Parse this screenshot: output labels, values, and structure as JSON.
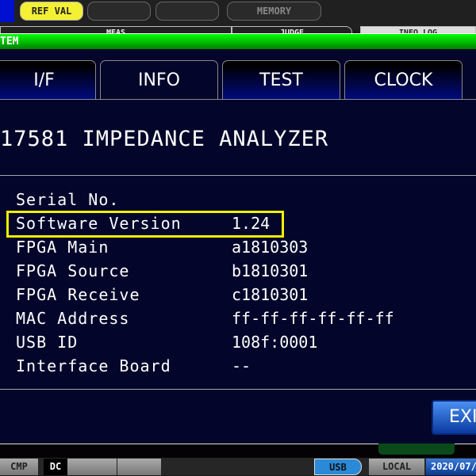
{
  "top_buttons": {
    "ref_val": "REF VAL",
    "btn2": "",
    "btn3": "",
    "memory": "MEMORY"
  },
  "behind_labels": {
    "meas": "MEAS",
    "judge": "JUDGE",
    "info_log": "INFO LOG"
  },
  "window_title": "TEM",
  "tabs": [
    {
      "label": "I/F"
    },
    {
      "label": "INFO",
      "active": true
    },
    {
      "label": "TEST"
    },
    {
      "label": "CLOCK"
    }
  ],
  "heading": "17581 IMPEDANCE ANALYZER",
  "info": [
    {
      "label": "Serial No.",
      "value": ""
    },
    {
      "label": "Software Version",
      "value": "1.24",
      "highlighted": true
    },
    {
      "label": "FPGA Main",
      "value": "a1810303"
    },
    {
      "label": "FPGA Source",
      "value": "b1810301"
    },
    {
      "label": "FPGA Receive",
      "value": "c1810301"
    },
    {
      "label": "MAC Address",
      "value": "ff-ff-ff-ff-ff-ff"
    },
    {
      "label": "USB ID",
      "value": "108f:0001"
    },
    {
      "label": "Interface Board",
      "value": "--"
    }
  ],
  "exit_label": "EXI",
  "status": {
    "cmp": "CMP",
    "dc": "DC",
    "usb": "USB",
    "local": "LOCAL",
    "date": "2020/07/"
  },
  "colors": {
    "highlight": "#f0f000",
    "title_bar": "#00ff00",
    "ref_val": "#f4f034",
    "panel": "#03062a"
  }
}
